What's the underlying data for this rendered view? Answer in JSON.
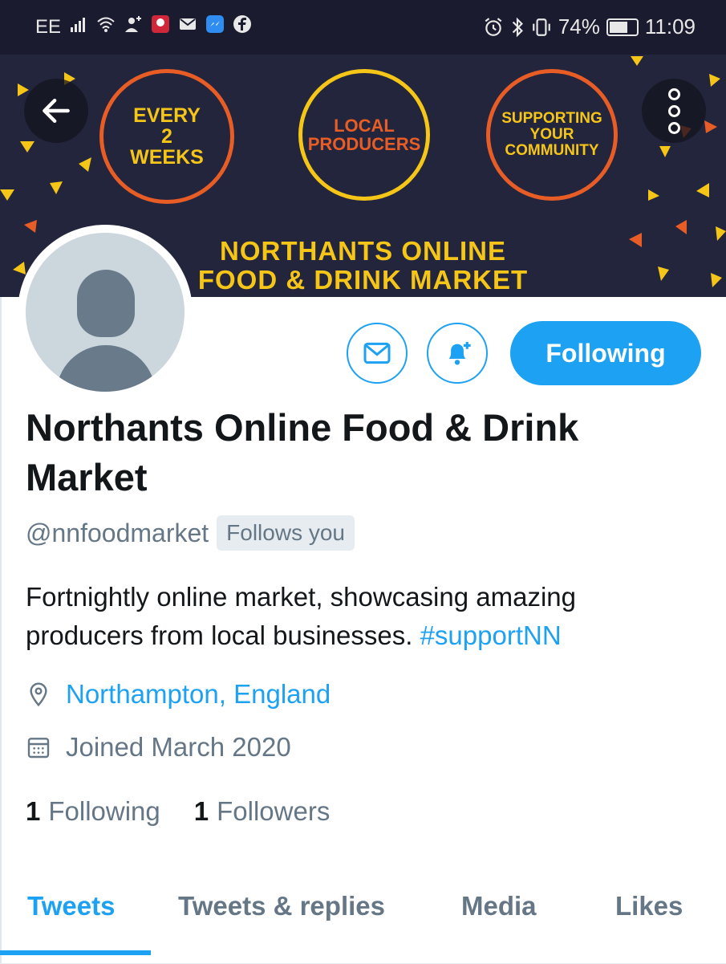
{
  "status_bar": {
    "carrier": "EE",
    "battery": "74%",
    "time": "11:09",
    "battery_level": 0.74,
    "icons_left": [
      "signal-icon",
      "wifi-icon",
      "person-add-icon",
      "huawei-app-icon",
      "gmail-icon",
      "messenger-icon",
      "facebook-icon"
    ],
    "icons_right": [
      "alarm-icon",
      "bluetooth-icon",
      "vibrate-icon"
    ]
  },
  "banner": {
    "circle1": "EVERY\n2\nWEEKS",
    "circle2": "LOCAL\nPRODUCERS",
    "circle3": "SUPPORTING\nYOUR\nCOMMUNITY",
    "title_line1": "NORTHANTS ONLINE",
    "title_line2": "FOOD & DRINK MARKET",
    "colors": {
      "background": "#23253d",
      "yellow": "#f5c518",
      "orange": "#e85d25"
    }
  },
  "actions": {
    "follow_label": "Following",
    "accent": "#1da1f2"
  },
  "profile": {
    "name": "Northants Online Food & Drink Market",
    "handle": "@nnfoodmarket",
    "follows_you": "Follows you",
    "bio_text": "Fortnightly online market, showcasing amazing producers from local businesses. ",
    "bio_hashtag": "#supportNN",
    "location": "Northampton, England",
    "joined": "Joined March 2020",
    "following_count": "1",
    "following_label": "Following",
    "followers_count": "1",
    "followers_label": "Followers"
  },
  "tabs": [
    {
      "label": "Tweets",
      "active": true
    },
    {
      "label": "Tweets & replies",
      "active": false
    },
    {
      "label": "Media",
      "active": false
    },
    {
      "label": "Likes",
      "active": false
    }
  ]
}
